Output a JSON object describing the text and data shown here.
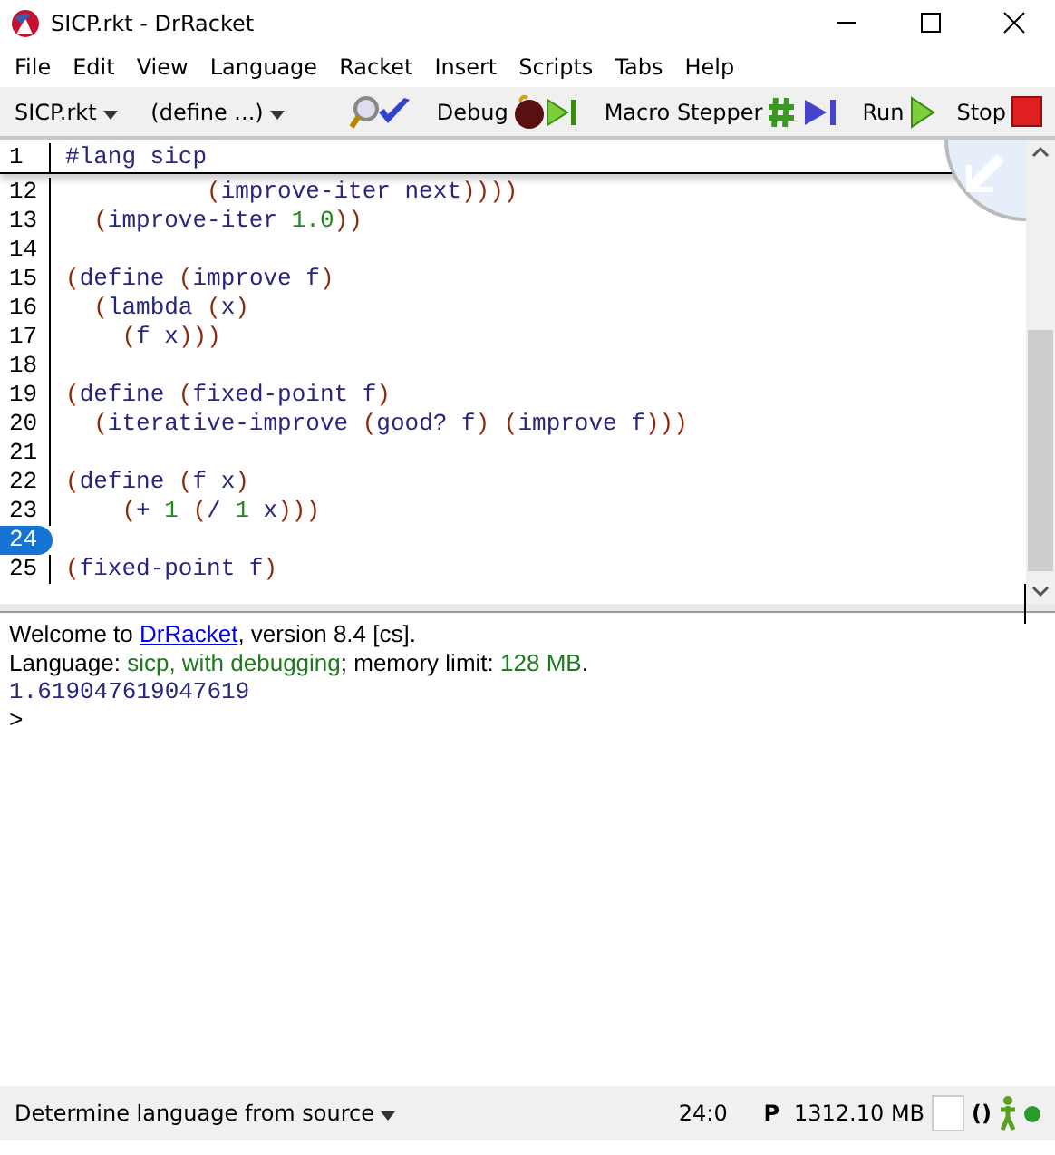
{
  "window": {
    "title": "SICP.rkt - DrRacket"
  },
  "menu": [
    "File",
    "Edit",
    "View",
    "Language",
    "Racket",
    "Insert",
    "Scripts",
    "Tabs",
    "Help"
  ],
  "toolbar": {
    "file_menu": "SICP.rkt",
    "define_menu": "(define ...)",
    "buttons": [
      {
        "kind": "check"
      },
      {
        "kind": "debug",
        "label": "Debug"
      },
      {
        "kind": "macro",
        "label": "Macro Stepper"
      },
      {
        "kind": "run",
        "label": "Run"
      },
      {
        "kind": "stop",
        "label": "Stop"
      }
    ]
  },
  "editor": {
    "header": {
      "number": "1",
      "code": "#lang sicp"
    },
    "lines": [
      {
        "number": "12",
        "code": "          (improve-iter next))))",
        "selected": false
      },
      {
        "number": "13",
        "code": "  (improve-iter 1.0))",
        "selected": false
      },
      {
        "number": "14",
        "selected": false
      },
      {
        "number": "15",
        "code": "(define (improve f)",
        "selected": false
      },
      {
        "number": "16",
        "code": "  (lambda (x)",
        "selected": false
      },
      {
        "number": "17",
        "code": "    (f x)))",
        "selected": false
      },
      {
        "number": "18",
        "selected": false
      },
      {
        "number": "19",
        "code": "(define (fixed-point f)",
        "selected": false
      },
      {
        "number": "20",
        "code": "  (iterative-improve (good? f) (improve f)))",
        "selected": false
      },
      {
        "number": "21",
        "selected": false
      },
      {
        "number": "22",
        "code": "(define (f x)",
        "selected": false
      },
      {
        "number": "23",
        "code": "    (+ 1 (/ 1 x)))",
        "selected": false
      },
      {
        "number": "24",
        "selected": true
      },
      {
        "number": "25",
        "code": "(fixed-point f)",
        "selected": false
      }
    ]
  },
  "interactions": {
    "welcome_prefix": "Welcome to ",
    "welcome_link": "DrRacket",
    "welcome_suffix": ", version 8.4 [cs].",
    "language_label": "Language: ",
    "language_value": "sicp, with debugging",
    "memory_label": "; memory limit: ",
    "memory_value": "128 MB",
    "memory_end": ".",
    "result": "1.619047619047619",
    "prompt": ">"
  },
  "status_bar": {
    "language": "Determine language from source",
    "position": "24:0",
    "mode": "P",
    "memory": "1312.10 MB",
    "parens": "()"
  }
}
